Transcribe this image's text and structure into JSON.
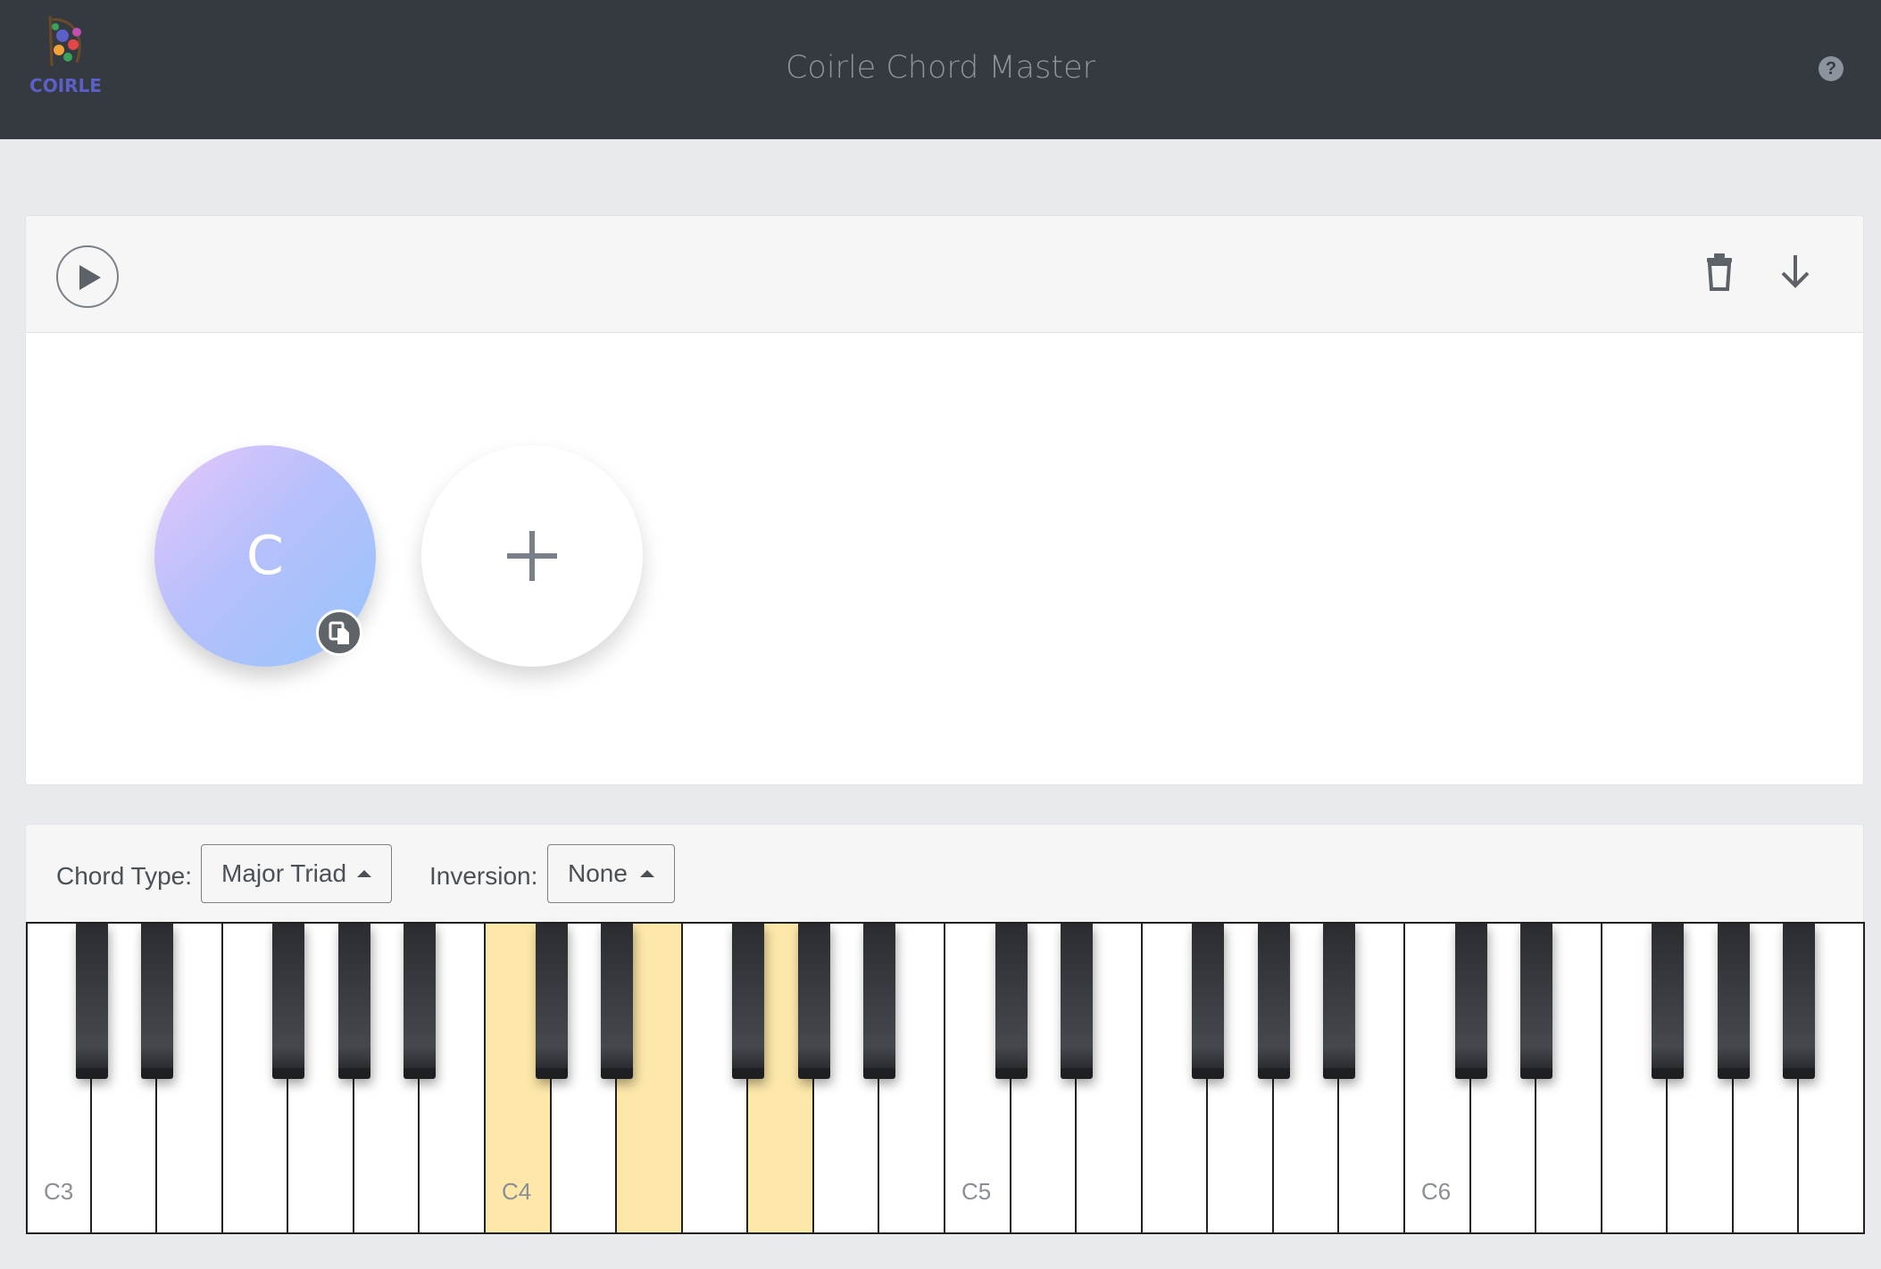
{
  "header": {
    "logo_text": "COIRLE",
    "title": "Coirle Chord Master",
    "help_icon": "question-circle-icon",
    "help_glyph": "?"
  },
  "progression": {
    "toolbar": {
      "play_icon": "play-icon",
      "trash_icon": "trash-icon",
      "download_icon": "arrow-down-icon"
    },
    "chords": [
      {
        "name": "C",
        "badge_icon": "copy-icon"
      }
    ],
    "add_icon": "plus-icon"
  },
  "controls": {
    "chord_type_label": "Chord Type:",
    "chord_type_value": "Major Triad",
    "inversion_label": "Inversion:",
    "inversion_value": "None"
  },
  "keyboard": {
    "octave_labels": [
      "C3",
      "C4",
      "C5",
      "C6"
    ],
    "highlighted_notes": [
      "C4",
      "E4",
      "G4"
    ],
    "highlight_color": "#fde8a9"
  },
  "colors": {
    "header_bg": "#343a40",
    "page_bg": "#e9eaed",
    "chord_gradient_start": "#e6c6fb",
    "chord_gradient_end": "#97c3fb"
  }
}
